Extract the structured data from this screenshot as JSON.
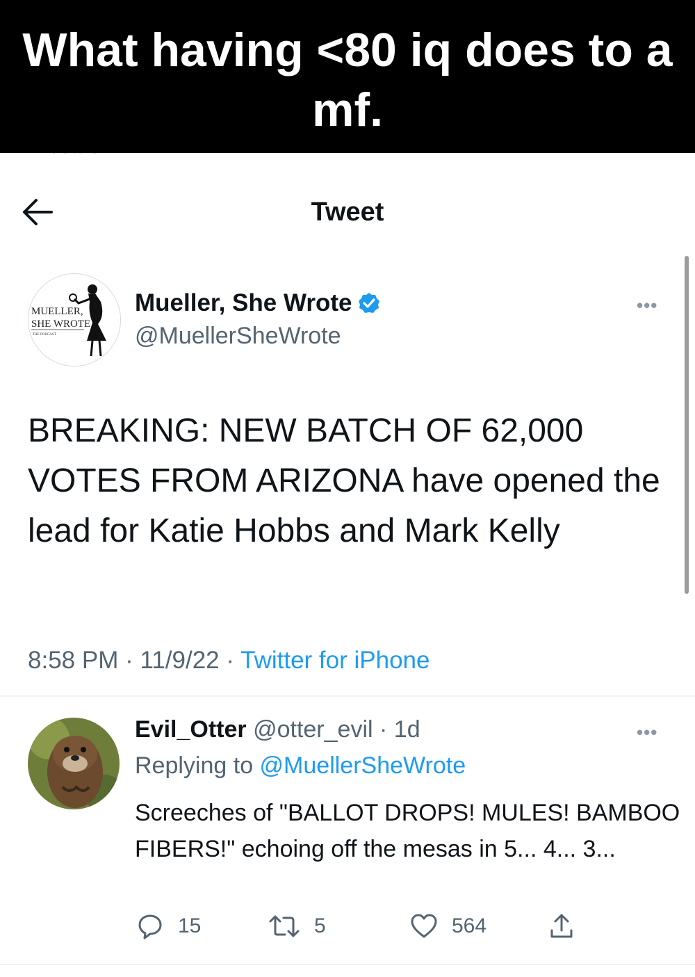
{
  "caption": {
    "text": "What having <80 iq does to a mf."
  },
  "status_bar": {
    "back_label": "◄ Search"
  },
  "nav": {
    "title": "Tweet",
    "back_icon": "arrow-left-icon"
  },
  "tweet": {
    "author": {
      "name": "Mueller, She Wrote",
      "handle": "@MuellerSheWrote",
      "verified": true,
      "avatar_text_line1": "MUELLER,",
      "avatar_text_line2": "SHE WROTE",
      "avatar_text_line3": "THE PODCAST"
    },
    "text": "BREAKING: NEW BATCH OF 62,000 VOTES FROM ARIZONA have opened the lead for Katie Hobbs and Mark Kelly",
    "time": "8:58 PM",
    "sep1": " · ",
    "date": "11/9/22",
    "sep2": " · ",
    "source": "Twitter for iPhone",
    "more_icon": "more-dots-icon"
  },
  "reply": {
    "name": "Evil_Otter",
    "handle": "@otter_evil",
    "sep": " · ",
    "age": "1d",
    "replying_prefix": "Replying to ",
    "replying_to": "@MuellerSheWrote",
    "text": "Screeches of \"BALLOT DROPS! MULES! BAMBOO FIBERS!\" echoing off the mesas in 5... 4... 3...",
    "actions": {
      "replies": "15",
      "retweets": "5",
      "likes": "564"
    }
  },
  "colors": {
    "accent": "#1d9bf0",
    "secondary_text": "#536471",
    "caption_bg": "#000000"
  }
}
